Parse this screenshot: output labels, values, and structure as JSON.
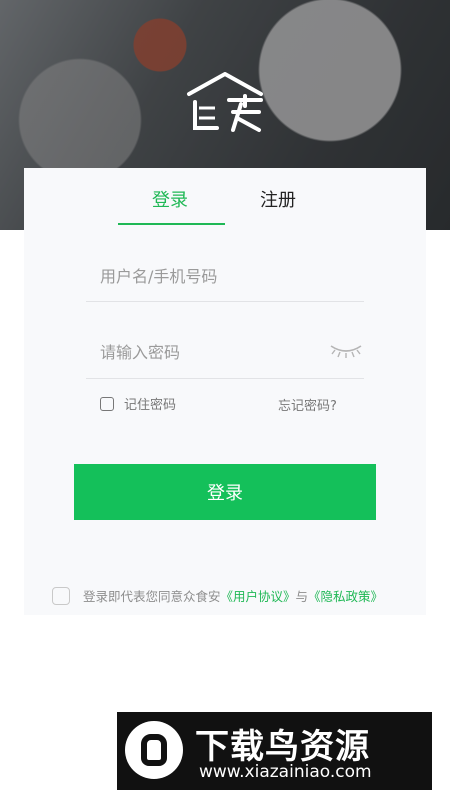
{
  "header": {
    "logo_label": "众食安"
  },
  "tabs": [
    {
      "label": "登录",
      "active": true
    },
    {
      "label": "注册",
      "active": false
    }
  ],
  "form": {
    "username_placeholder": "用户名/手机号码",
    "username_value": "",
    "password_placeholder": "请输入密码",
    "password_value": "",
    "remember_label": "记住密码",
    "remember_checked": false,
    "forgot_label": "忘记密码?",
    "submit_label": "登录"
  },
  "agreement": {
    "checked": false,
    "prefix": "登录即代表您同意众食安",
    "user_agreement": "《用户协议》",
    "connector": "与",
    "privacy_policy": "《隐私政策》"
  },
  "watermark": {
    "name": "下载鸟资源",
    "url": "www.xiazainiao.com"
  },
  "colors": {
    "accent": "#1fb855",
    "button": "#14c05a",
    "card_bg": "#f8f9fb"
  }
}
